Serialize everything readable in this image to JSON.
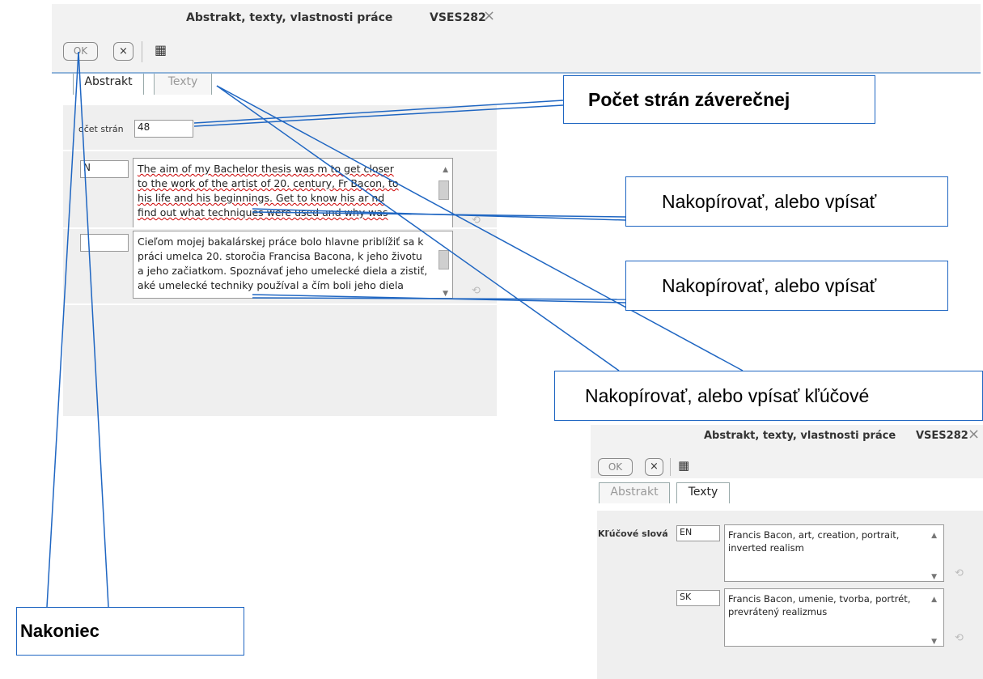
{
  "dialog1": {
    "title": "Abstrakt, texty, vlastnosti práce",
    "code": "VSES282",
    "close_icon": "×",
    "ok_label": "OK",
    "cancel_label": "×",
    "grid_icon": "▦",
    "tabs": [
      {
        "label": "Abstrakt"
      },
      {
        "label": "Texty"
      }
    ],
    "pages_label": "očet strán",
    "pages_value": "48",
    "en_lang_value": "N",
    "sk_lang_value": "",
    "en_text_lines": [
      "The aim of my Bachelor thesis was m      to get closer",
      "to the work of the artist of 20. century, Fr      Bacon, to",
      "his life and his beginnings. Get to know his ar         nd",
      "find out what techniques were used and why was"
    ],
    "sk_text_lines": [
      "Cieľom mojej bakalárskej práce bolo hlavne priblížiť sa k",
      "práci umelca 20. storočia Francisa Bacona, k jeho životu",
      "a jeho začiatkom. Spoznávať jeho umelecké diela a zistiť,",
      "aké umelecké techniky používal a čím boli jeho diela"
    ]
  },
  "callouts": {
    "pocet": "Počet strán záverečnej",
    "nakop1": "Nakopírovať, alebo vpísať",
    "nakop2": "Nakopírovať, alebo vpísať",
    "nakop3": "Nakopírovať, alebo vpísať kľúčové",
    "nakoniec": "Nakoniec"
  },
  "dialog2": {
    "title": "Abstrakt, texty, vlastnosti práce",
    "code": "VSES282",
    "close_icon": "×",
    "ok_label": "OK",
    "cancel_label": "×",
    "grid_icon": "▦",
    "tabs": [
      {
        "label": "Abstrakt"
      },
      {
        "label": "Texty"
      }
    ],
    "keywords_label": "Kľúčové slová",
    "en_lang_value": "EN",
    "sk_lang_value": "SK",
    "en_keywords": "Francis Bacon, art, creation, portrait, inverted realism",
    "sk_keywords": " Francis Bacon, umenie, tvorba, portrét, prevrátený realizmus"
  },
  "colors": {
    "callout_border": "#1f66c2",
    "leader_line": "#1f66c2",
    "panel_bg": "#efefef",
    "tab_underline": "#8fb3d9"
  }
}
